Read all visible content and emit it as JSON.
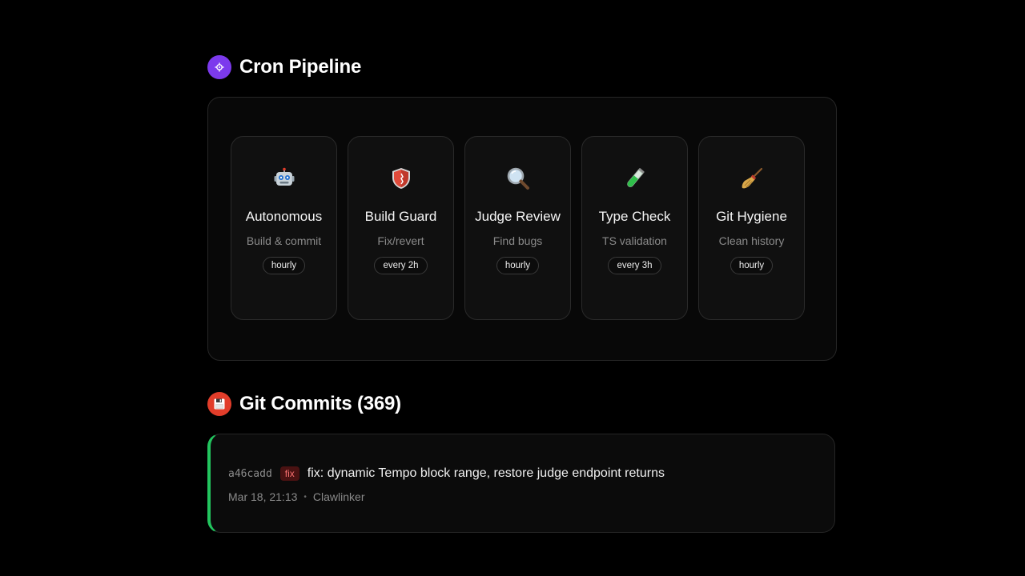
{
  "cron": {
    "title": "Cron Pipeline",
    "icon": "gear-icon",
    "cards": [
      {
        "name": "Autonomous",
        "desc": "Build & commit",
        "schedule": "hourly",
        "icon": "robot-icon"
      },
      {
        "name": "Build Guard",
        "desc": "Fix/revert",
        "schedule": "every 2h",
        "icon": "shield-icon"
      },
      {
        "name": "Judge Review",
        "desc": "Find bugs",
        "schedule": "hourly",
        "icon": "magnifier-icon"
      },
      {
        "name": "Type Check",
        "desc": "TS validation",
        "schedule": "every 3h",
        "icon": "test-tube-icon"
      },
      {
        "name": "Git Hygiene",
        "desc": "Clean history",
        "schedule": "hourly",
        "icon": "broom-icon"
      }
    ]
  },
  "git": {
    "title": "Git Commits (369)",
    "icon": "floppy-disk-icon",
    "commits": [
      {
        "hash": "a46cadd",
        "type": "fix",
        "message": "fix: dynamic Tempo block range, restore judge endpoint returns",
        "date": "Mar 18, 21:13",
        "author": "Clawlinker"
      }
    ]
  },
  "colors": {
    "background": "#000000",
    "cron_icon": "#7c3aed",
    "git_icon": "#e23d2a",
    "commit_accent": "#22c55e",
    "fix_badge_text": "#f87171",
    "fix_badge_bg": "#4a1212"
  }
}
